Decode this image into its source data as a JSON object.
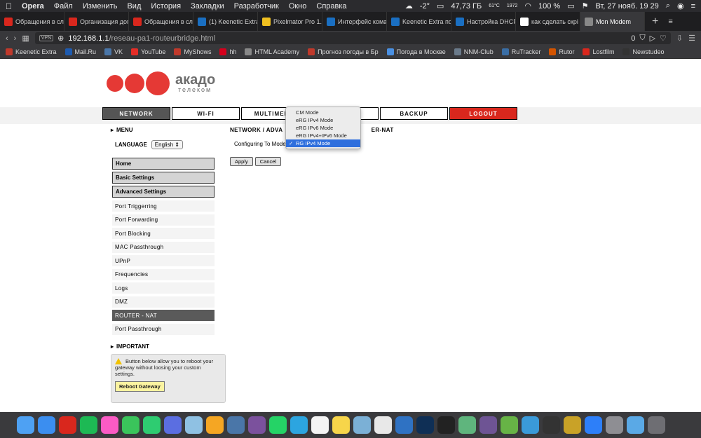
{
  "menubar": {
    "app_name": "Opera",
    "items": [
      "Файл",
      "Изменить",
      "Вид",
      "История",
      "Закладки",
      "Разработчик",
      "Окно",
      "Справка"
    ],
    "temperature": "-2°",
    "storage": "47,73 ГБ",
    "cpu_temp": "61°C",
    "fan": "1972",
    "battery": "100 %",
    "datetime": "Вт, 27 нояб.  19 29"
  },
  "tabs": [
    {
      "label": "Обращения в слу",
      "color": "#d9271d"
    },
    {
      "label": "Организация доп",
      "color": "#d9271d"
    },
    {
      "label": "Обращения в слу",
      "color": "#d9271d"
    },
    {
      "label": "(1) Keenetic Extra",
      "color": "#1a6fc2"
    },
    {
      "label": "Pixelmator Pro 1.2",
      "color": "#f0c020"
    },
    {
      "label": "Интерфейс кома",
      "color": "#1a6fc2"
    },
    {
      "label": "Keenetic Extra по",
      "color": "#1a6fc2"
    },
    {
      "label": "Настройка DHCP",
      "color": "#1a6fc2"
    },
    {
      "label": "как сделать скрі",
      "color": "#ffffff"
    },
    {
      "label": "Mon Modem",
      "color": "#888888"
    }
  ],
  "address": {
    "vpn": "VPN",
    "url_host": "192.168.1.1",
    "url_path": "/reseau-pa1-routeurbridge.html",
    "counter": "0"
  },
  "bookmarks": [
    {
      "label": "Keenetic Extra",
      "color": "#c0392b"
    },
    {
      "label": "Mail.Ru",
      "color": "#1e5bb0"
    },
    {
      "label": "VK",
      "color": "#4a76a8"
    },
    {
      "label": "YouTube",
      "color": "#e52d27"
    },
    {
      "label": "MyShows",
      "color": "#c0392b"
    },
    {
      "label": "hh",
      "color": "#d6001c"
    },
    {
      "label": "HTML Academy",
      "color": "#888888"
    },
    {
      "label": "Прогноз погоды в Бр",
      "color": "#c0392b"
    },
    {
      "label": "Погода в Москве",
      "color": "#4a90e2"
    },
    {
      "label": "NNM-Club",
      "color": "#6a7a8a"
    },
    {
      "label": "RuTracker",
      "color": "#3a6ea5"
    },
    {
      "label": "Rutor",
      "color": "#d35400"
    },
    {
      "label": "Lostfilm",
      "color": "#d9271d"
    },
    {
      "label": "Newstudeo",
      "color": "#333333"
    }
  ],
  "logo": {
    "line1": "акадо",
    "line2": "телеком"
  },
  "nav": [
    {
      "label": "NETWORK",
      "state": "active"
    },
    {
      "label": "WI-FI",
      "state": "normal"
    },
    {
      "label": "MULTIMEDIA",
      "state": "normal"
    },
    {
      "label": "",
      "state": "normal"
    },
    {
      "label": "BACKUP",
      "state": "normal"
    },
    {
      "label": "LOGOUT",
      "state": "logout"
    }
  ],
  "sidebar": {
    "menu_title": "MENU",
    "language_label": "LANGUAGE",
    "language_value": "English",
    "sections": [
      "Home",
      "Basic Settings",
      "Advanced Settings"
    ],
    "items": [
      {
        "label": "Port Triggerring",
        "active": false
      },
      {
        "label": "Port Forwarding",
        "active": false
      },
      {
        "label": "Port Blocking",
        "active": false
      },
      {
        "label": "MAC Passthrough",
        "active": false
      },
      {
        "label": "UPnP",
        "active": false
      },
      {
        "label": "Frequencies",
        "active": false
      },
      {
        "label": "Logs",
        "active": false
      },
      {
        "label": "DMZ",
        "active": false
      },
      {
        "label": "ROUTER - NAT",
        "active": true
      },
      {
        "label": "Port Passthrough",
        "active": false
      }
    ],
    "important_title": "IMPORTANT",
    "important_text": "Button below allow you to reboot your gateway without loosing your custom settings.",
    "reboot_label": "Reboot Gateway"
  },
  "main": {
    "crumb_left": "NETWORK / ADVA",
    "crumb_right": "ER-NAT",
    "config_label": "Configuring To Mode:",
    "apply_label": "Apply",
    "cancel_label": "Cancel"
  },
  "dropdown": {
    "options": [
      "CM Mode",
      "eRG IPv4 Mode",
      "eRG IPv6 Mode",
      "eRG IPv4+IPv6 Mode",
      "RG IPv4 Mode"
    ],
    "selected": "RG IPv4 Mode"
  },
  "dock": {
    "apps": [
      {
        "name": "finder",
        "color": "#4ea1f3"
      },
      {
        "name": "safari",
        "color": "#3b8ef0"
      },
      {
        "name": "opera",
        "color": "#d9271d"
      },
      {
        "name": "spotify",
        "color": "#1db954"
      },
      {
        "name": "itunes",
        "color": "#fb5bc5"
      },
      {
        "name": "facetime",
        "color": "#3ac45b"
      },
      {
        "name": "messages",
        "color": "#2ecc71"
      },
      {
        "name": "launchpad",
        "color": "#5b6ee1"
      },
      {
        "name": "maps",
        "color": "#8fc1e3"
      },
      {
        "name": "photos",
        "color": "#f5a623"
      },
      {
        "name": "vk",
        "color": "#4a76a8"
      },
      {
        "name": "viber",
        "color": "#7b519d"
      },
      {
        "name": "whatsapp",
        "color": "#25d366"
      },
      {
        "name": "telegram",
        "color": "#2ca5e0"
      },
      {
        "name": "calendar",
        "color": "#f4f4f4"
      },
      {
        "name": "notes",
        "color": "#f7d54a"
      },
      {
        "name": "preview",
        "color": "#7bb0d6"
      },
      {
        "name": "textedit",
        "color": "#e8e8e8"
      },
      {
        "name": "keynote",
        "color": "#2f72c3"
      },
      {
        "name": "photoshop",
        "color": "#0f2f55"
      },
      {
        "name": "terminal",
        "color": "#222222"
      },
      {
        "name": "atom",
        "color": "#5fb57d"
      },
      {
        "name": "github",
        "color": "#6e5494"
      },
      {
        "name": "utorrent",
        "color": "#67b346"
      },
      {
        "name": "files",
        "color": "#3a9ad9"
      },
      {
        "name": "activity",
        "color": "#333333"
      },
      {
        "name": "disk",
        "color": "#c9a227"
      },
      {
        "name": "appstore",
        "color": "#2d7ff9"
      },
      {
        "name": "preferences",
        "color": "#8e8e93"
      },
      {
        "name": "folder",
        "color": "#5aa9e6"
      },
      {
        "name": "trash",
        "color": "#6e6e73"
      }
    ]
  }
}
